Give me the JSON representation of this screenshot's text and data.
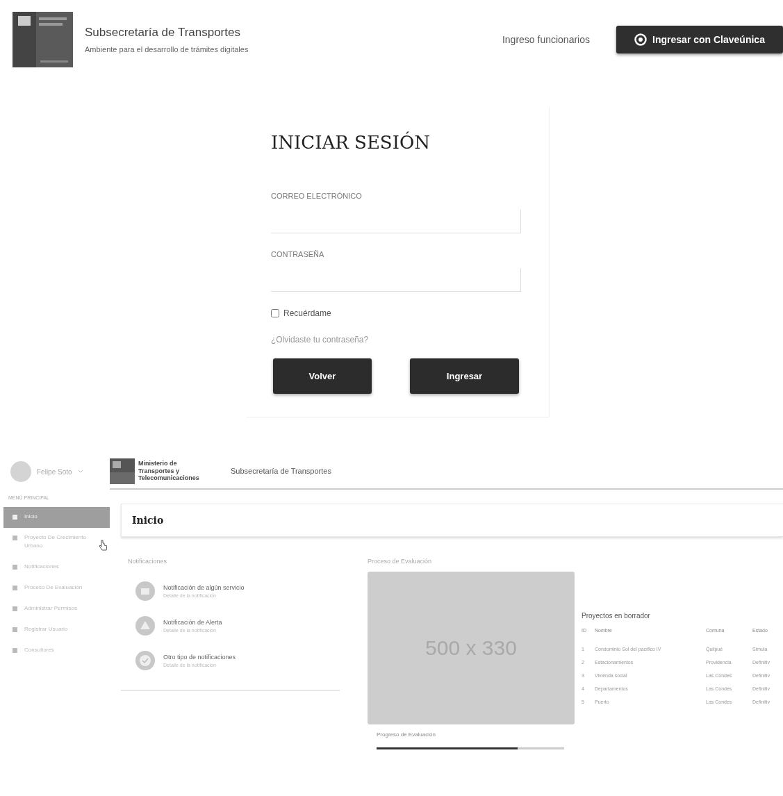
{
  "header": {
    "title": "Subsecretaría de Transportes",
    "subtitle": "Ambiente para el desarrollo de trámites digitales",
    "staff_link": "Ingreso funcionarios",
    "login_button": "Ingresar con Claveúnica"
  },
  "login": {
    "title": "INICIAR SESIÓN",
    "email_label": "CORREO ELECTRÓNICO",
    "password_label": "CONTRASEÑA",
    "remember": {
      "label": "Recuérdame",
      "checked": false
    },
    "forgot": "¿Olvidaste tu contraseña?",
    "buttons": [
      "Volver",
      "Ingresar"
    ]
  },
  "dashboard": {
    "user": "Felipe Soto",
    "ministry": "Ministerio de Transportes y Telecomunicaciones",
    "agency": "Subsecretaría de Transportes",
    "menu_title": "MENÚ PRINCIPAL",
    "menu": [
      {
        "label": "Inicio",
        "selected": true
      },
      {
        "label": "Proyecto De Crecimiento Urbano",
        "selected": false
      },
      {
        "label": "Notificaciones",
        "selected": false
      },
      {
        "label": "Proceso De Evaluación",
        "selected": false
      },
      {
        "label": "Administrar Permisos",
        "selected": false
      },
      {
        "label": "Registrar Usuario",
        "selected": false
      },
      {
        "label": "Consultores",
        "selected": false
      }
    ],
    "page_title": "Inicio",
    "notifications_title": "Notificaciones",
    "notifications": [
      {
        "kind": "mail",
        "title": "Notificación de algún servicio",
        "detail": "Detalle de la notificación"
      },
      {
        "kind": "alert",
        "title": "Notificación de Alerta",
        "detail": "Detalle de la notificación"
      },
      {
        "kind": "check",
        "title": "Otro tipo de notificaciones",
        "detail": "Detalle de la notificación"
      }
    ],
    "process_title": "Proceso de Evaluación",
    "placeholder_image": "500 x 330",
    "progress": {
      "label": "Progreso de Evaluación",
      "level": 0.75
    },
    "drafts": {
      "title": "Proyectos en borrador",
      "columns": [
        "ID",
        "Nombre",
        "Comuna",
        "Estado"
      ],
      "rows": [
        [
          "1",
          "Condominio Sol del pacífico IV",
          "Quilpué",
          "Simula"
        ],
        [
          "2",
          "Estacionamientos",
          "Providencia",
          "Definitiv"
        ],
        [
          "3",
          "Vivienda social",
          "Las Condes",
          "Definitiv"
        ],
        [
          "4",
          "Departamentos",
          "Las Condes",
          "Definitiv"
        ],
        [
          "5",
          "Puerto",
          "Las Condes",
          "Definitiv"
        ]
      ]
    }
  }
}
